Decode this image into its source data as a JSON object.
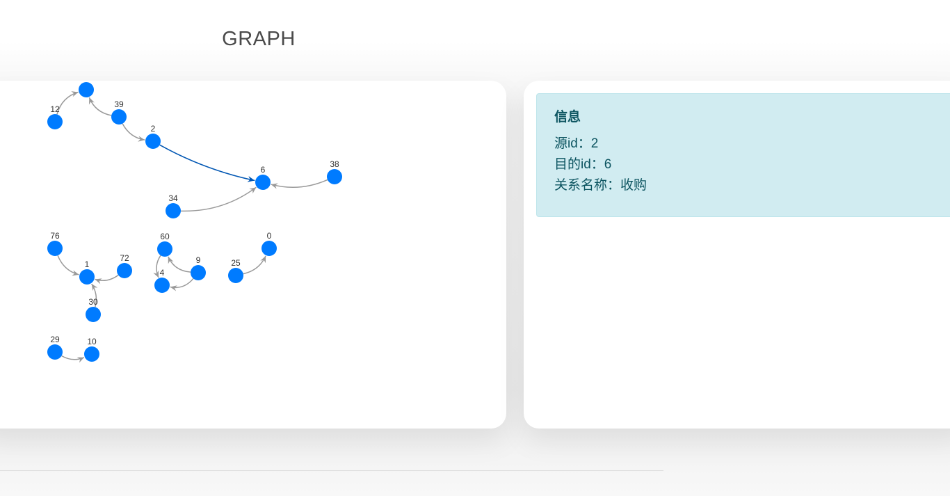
{
  "header": {
    "title": "GRAPH"
  },
  "graph": {
    "node_color": "#007bff",
    "edge_color": "#999999",
    "selected_edge_color": "#0056b3",
    "nodes": [
      {
        "id": "n-top",
        "label": ""
      },
      {
        "id": "12",
        "label": "12"
      },
      {
        "id": "39",
        "label": "39"
      },
      {
        "id": "2",
        "label": "2"
      },
      {
        "id": "6",
        "label": "6"
      },
      {
        "id": "38",
        "label": "38"
      },
      {
        "id": "34",
        "label": "34"
      },
      {
        "id": "76",
        "label": "76"
      },
      {
        "id": "1",
        "label": "1"
      },
      {
        "id": "72",
        "label": "72"
      },
      {
        "id": "30",
        "label": "30"
      },
      {
        "id": "60",
        "label": "60"
      },
      {
        "id": "4",
        "label": "4"
      },
      {
        "id": "9",
        "label": "9"
      },
      {
        "id": "25",
        "label": "25"
      },
      {
        "id": "0",
        "label": "0"
      },
      {
        "id": "29",
        "label": "29"
      },
      {
        "id": "10",
        "label": "10"
      }
    ],
    "edges": [
      {
        "source": "12",
        "target": "n-top",
        "selected": false
      },
      {
        "source": "39",
        "target": "n-top",
        "selected": false
      },
      {
        "source": "39",
        "target": "2",
        "selected": false
      },
      {
        "source": "2",
        "target": "6",
        "selected": true
      },
      {
        "source": "38",
        "target": "6",
        "selected": false
      },
      {
        "source": "34",
        "target": "6",
        "selected": false
      },
      {
        "source": "76",
        "target": "1",
        "selected": false
      },
      {
        "source": "72",
        "target": "1",
        "selected": false
      },
      {
        "source": "30",
        "target": "1",
        "selected": false
      },
      {
        "source": "60",
        "target": "4",
        "selected": false
      },
      {
        "source": "9",
        "target": "60",
        "selected": false
      },
      {
        "source": "9",
        "target": "4",
        "selected": false
      },
      {
        "source": "25",
        "target": "0",
        "selected": false
      },
      {
        "source": "29",
        "target": "10",
        "selected": false
      }
    ]
  },
  "info": {
    "heading": "信息",
    "source_id": "源id：2",
    "target_id": "目的id：6",
    "relation_name": "关系名称：收购"
  }
}
